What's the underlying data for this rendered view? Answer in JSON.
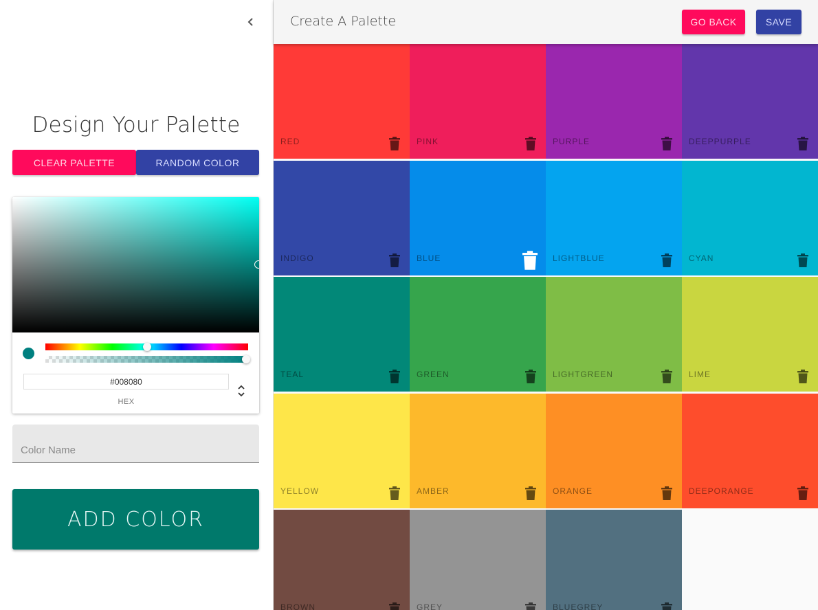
{
  "drawer": {
    "title": "Design Your Palette",
    "clear_label": "Clear Palette",
    "random_label": "Random Color",
    "picker": {
      "current_color": "#008080",
      "hex_value": "#008080",
      "hex_label": "HEX"
    },
    "name_placeholder": "Color Name",
    "add_label": "ADD COLOR"
  },
  "appbar": {
    "title": "Create A Palette",
    "go_back_label": "Go Back",
    "save_label": "Save"
  },
  "palette": [
    {
      "name": "red",
      "color": "#ff3a37"
    },
    {
      "name": "pink",
      "color": "#ef1e5b"
    },
    {
      "name": "purple",
      "color": "#9a27ae"
    },
    {
      "name": "deeppurple",
      "color": "#6236ab"
    },
    {
      "name": "indigo",
      "color": "#3248a7"
    },
    {
      "name": "blue",
      "color": "#058cea"
    },
    {
      "name": "lightblue",
      "color": "#04a4ef"
    },
    {
      "name": "cyan",
      "color": "#02b6d0"
    },
    {
      "name": "teal",
      "color": "#028878"
    },
    {
      "name": "green",
      "color": "#36a54c"
    },
    {
      "name": "lightgreen",
      "color": "#7fbd46"
    },
    {
      "name": "lime",
      "color": "#c9d640"
    },
    {
      "name": "yellow",
      "color": "#fee649"
    },
    {
      "name": "amber",
      "color": "#fdb92b"
    },
    {
      "name": "orange",
      "color": "#fe8f24"
    },
    {
      "name": "deeporange",
      "color": "#fe4d2c"
    },
    {
      "name": "brown",
      "color": "#724b42"
    },
    {
      "name": "grey",
      "color": "#949494"
    },
    {
      "name": "bluegrey",
      "color": "#527080"
    }
  ],
  "icons": {
    "collapse": "chevron-left-icon",
    "delete": "trash-icon",
    "mode_toggle": "unfold-icon"
  }
}
